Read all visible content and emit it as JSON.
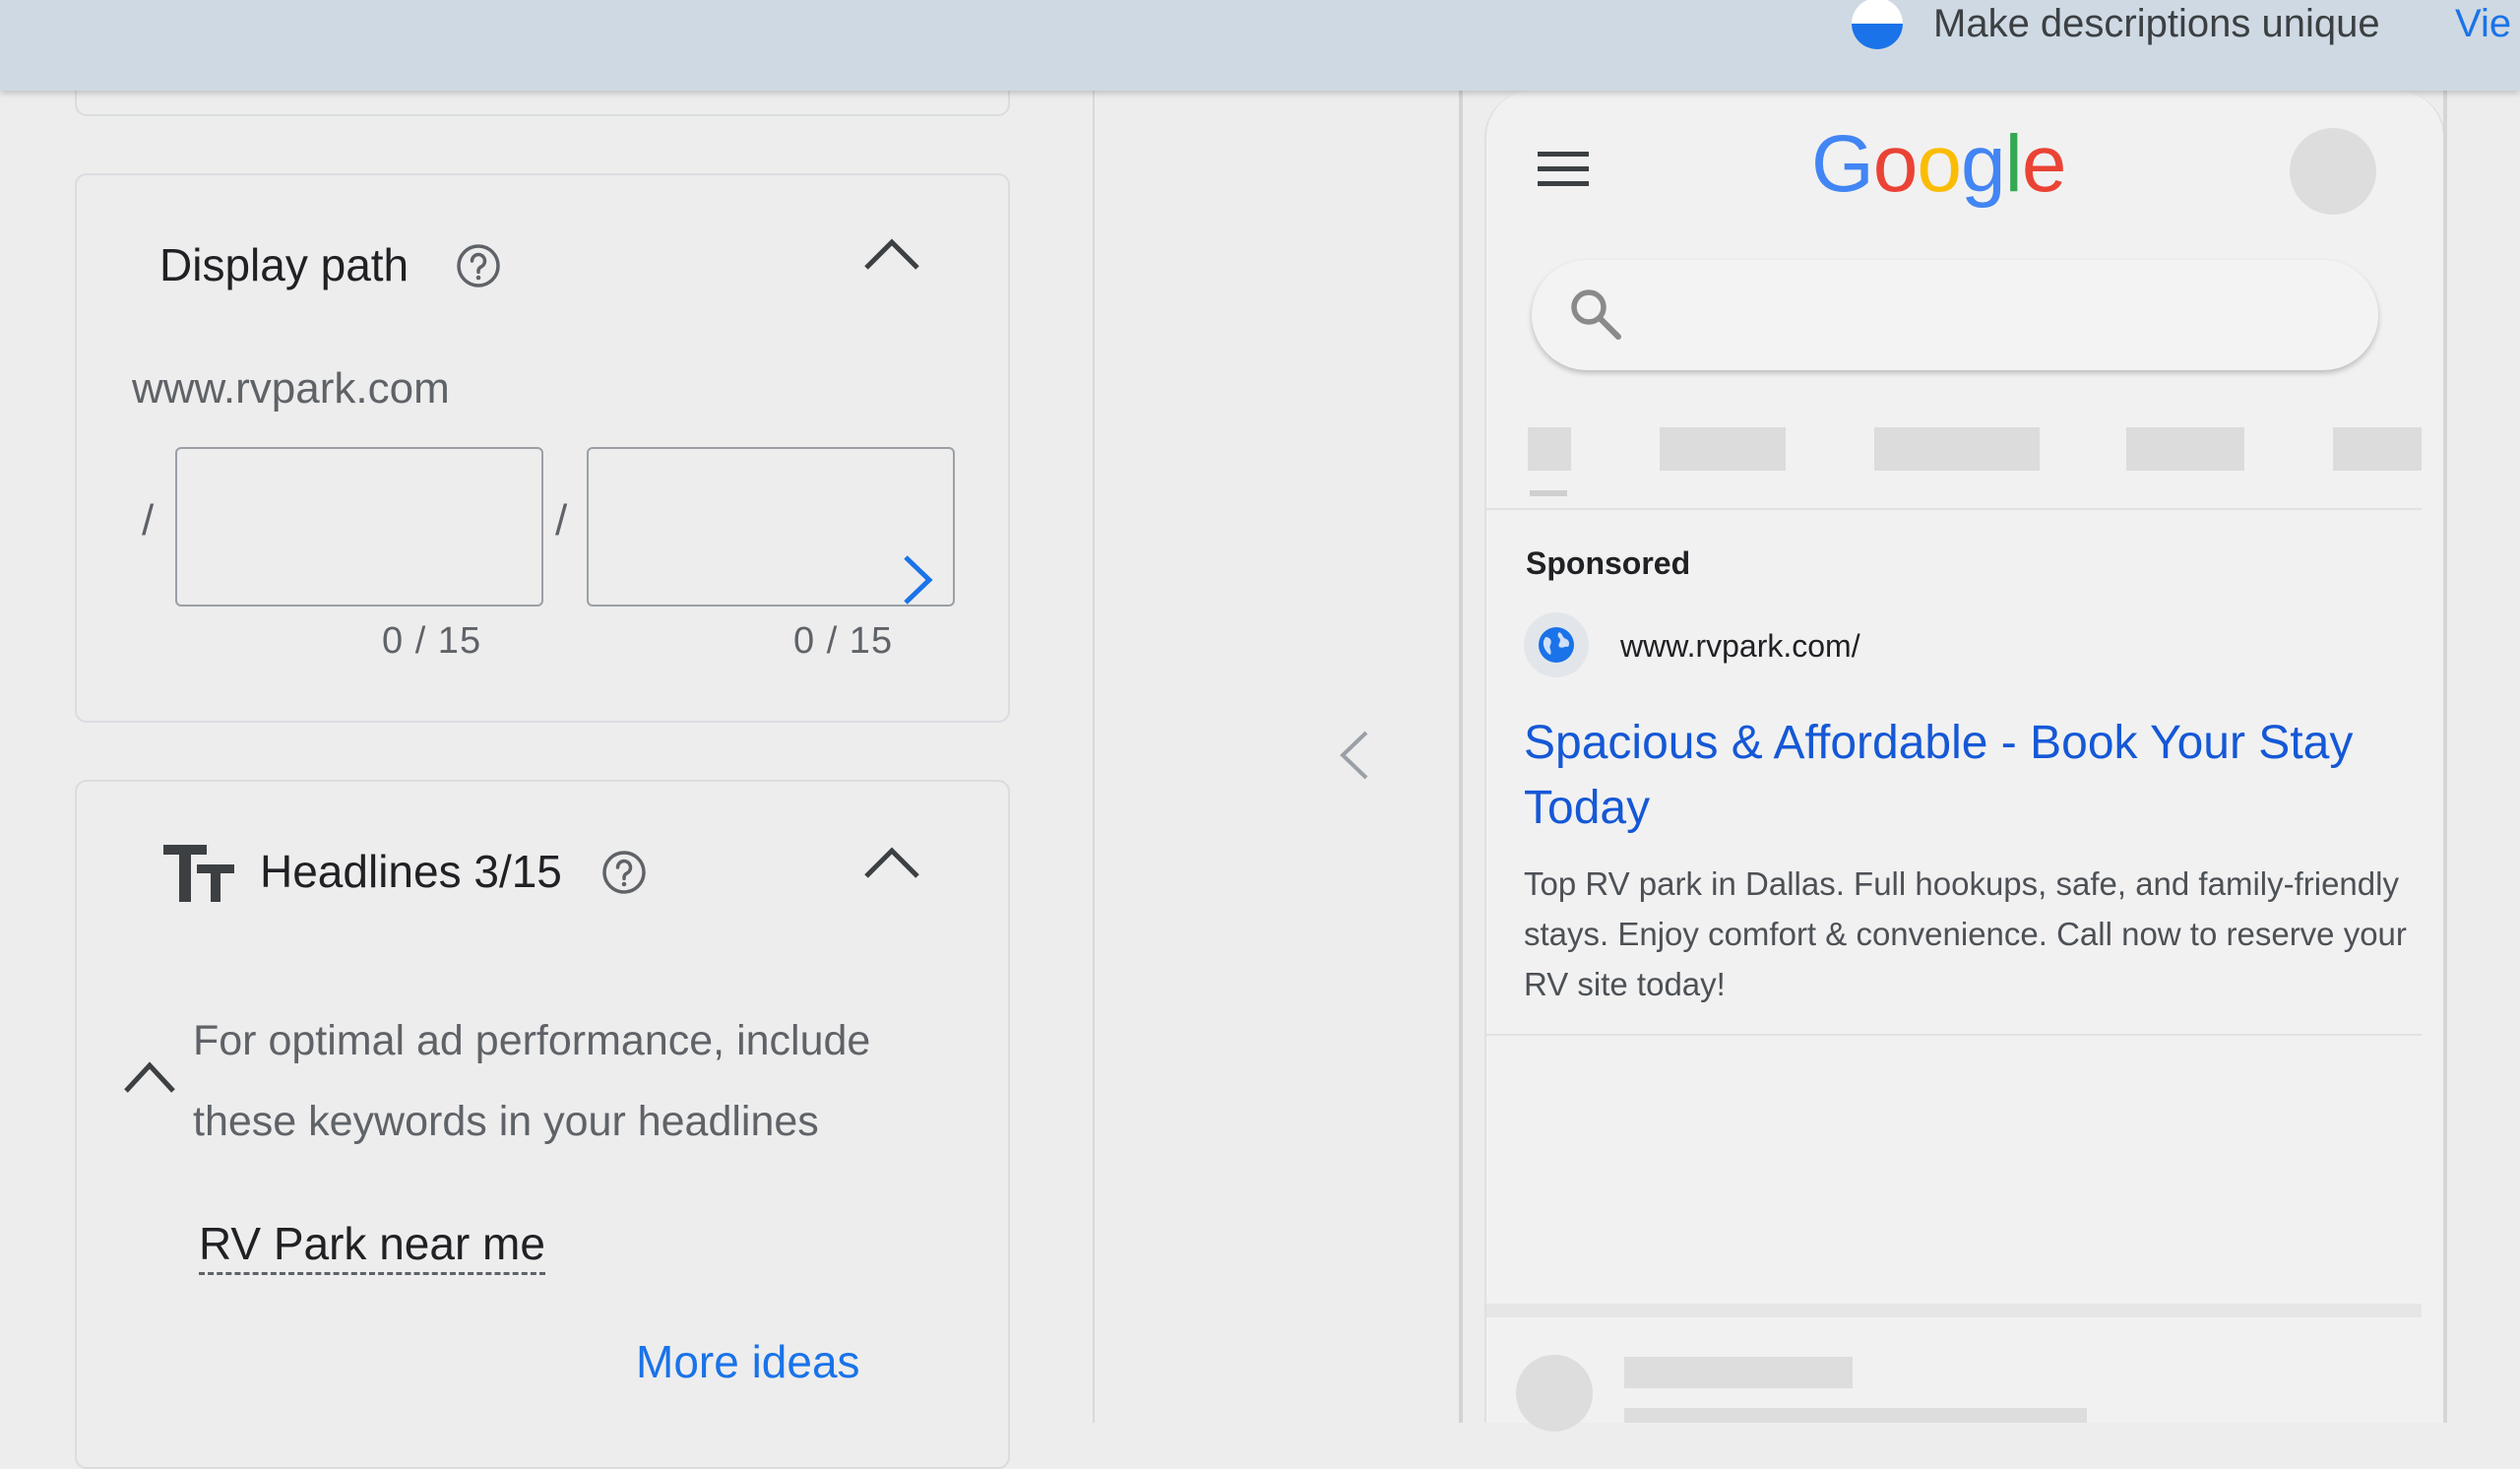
{
  "banner": {
    "text": "Make descriptions unique",
    "link": "Vie",
    "progress": 0.5,
    "colors": {
      "fill": "#1a73e8",
      "track": "#ffffff"
    }
  },
  "display_path": {
    "title": "Display path",
    "url": "www.rvpark.com",
    "separator": "/",
    "path1": {
      "value": "",
      "counter": "0 / 15"
    },
    "path2": {
      "value": "",
      "counter": "0 / 15"
    }
  },
  "headlines": {
    "title": "Headlines 3/15",
    "tip": "For optimal ad performance, include these keywords in your headlines",
    "keyword": "RV Park near me",
    "more_ideas": "More ideas"
  },
  "preview": {
    "logo": [
      {
        "ch": "G",
        "color": "#4285f4"
      },
      {
        "ch": "o",
        "color": "#ea4335"
      },
      {
        "ch": "o",
        "color": "#fbbc05"
      },
      {
        "ch": "g",
        "color": "#4285f4"
      },
      {
        "ch": "l",
        "color": "#34a853"
      },
      {
        "ch": "e",
        "color": "#ea4335"
      }
    ],
    "sponsored": "Sponsored",
    "display_url": "www.rvpark.com/",
    "headline": "Spacious & Affordable - Book Your Stay Today",
    "description": "Top RV park in Dallas. Full hookups, safe, and family-friendly stays. Enjoy comfort & convenience. Call now to reserve your RV site today!"
  },
  "icons": {
    "banner": "progress-circle-icon",
    "help": "help-circle-icon",
    "collapse": "chevron-up-icon",
    "headline_type": "text-size-icon",
    "next": "chevron-right-icon",
    "panel_toggle": "chevron-left-icon",
    "menu": "hamburger-menu-icon",
    "search": "search-icon",
    "favicon": "globe-icon"
  }
}
